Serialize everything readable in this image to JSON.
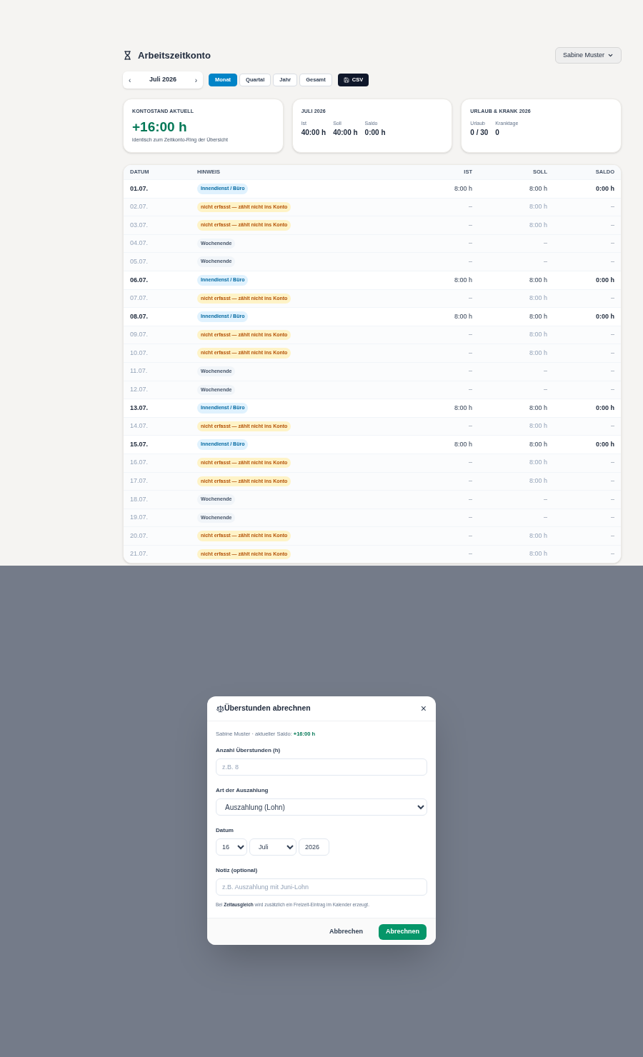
{
  "header": {
    "title": "Arbeitszeitkonto",
    "employee": "Sabine Muster"
  },
  "period_nav": {
    "prev": "‹",
    "label": "Juli 2026",
    "next": "›"
  },
  "ranges": [
    {
      "label": "Monat",
      "selected": true
    },
    {
      "label": "Quartal",
      "selected": false
    },
    {
      "label": "Jahr",
      "selected": false
    },
    {
      "label": "Gesamt",
      "selected": false
    }
  ],
  "export_button": "CSV",
  "cards": [
    {
      "kind": "balance",
      "title": "KONTOSTAND AKTUELL",
      "value": "+16:00 h",
      "caption": "identisch zum Zeitkonto-Ring der Übersicht"
    },
    {
      "kind": "stats",
      "title": "JULI 2026",
      "stats": [
        {
          "label": "Ist",
          "value": "40:00 h"
        },
        {
          "label": "Soll",
          "value": "40:00 h"
        },
        {
          "label": "Saldo",
          "value": "0:00 h"
        }
      ]
    },
    {
      "kind": "stats",
      "title": "URLAUB & KRANK 2026",
      "stats": [
        {
          "label": "Urlaub",
          "value": "0 / 30"
        },
        {
          "label": "Kranktage",
          "value": "0"
        }
      ]
    }
  ],
  "table": {
    "columns": [
      "DATUM",
      "HINWEIS",
      "IST",
      "SOLL",
      "SALDO"
    ],
    "rows": [
      {
        "kind": "office",
        "date": "01.07.",
        "note": "Innendienst / Büro",
        "ist": "8:00 h",
        "soll": "8:00 h",
        "saldo": "0:00 h"
      },
      {
        "kind": "missing",
        "date": "02.07.",
        "note": "nicht erfasst — zählt nicht ins Konto",
        "ist": "–",
        "soll": "8:00 h",
        "saldo": "–"
      },
      {
        "kind": "missing",
        "date": "03.07.",
        "note": "nicht erfasst — zählt nicht ins Konto",
        "ist": "–",
        "soll": "8:00 h",
        "saldo": "–"
      },
      {
        "kind": "weekend",
        "date": "04.07.",
        "note": "Wochenende",
        "ist": "–",
        "soll": "–",
        "saldo": "–"
      },
      {
        "kind": "weekend",
        "date": "05.07.",
        "note": "Wochenende",
        "ist": "–",
        "soll": "–",
        "saldo": "–"
      },
      {
        "kind": "office",
        "date": "06.07.",
        "note": "Innendienst / Büro",
        "ist": "8:00 h",
        "soll": "8:00 h",
        "saldo": "0:00 h"
      },
      {
        "kind": "missing",
        "date": "07.07.",
        "note": "nicht erfasst — zählt nicht ins Konto",
        "ist": "–",
        "soll": "8:00 h",
        "saldo": "–"
      },
      {
        "kind": "office",
        "date": "08.07.",
        "note": "Innendienst / Büro",
        "ist": "8:00 h",
        "soll": "8:00 h",
        "saldo": "0:00 h"
      },
      {
        "kind": "missing",
        "date": "09.07.",
        "note": "nicht erfasst — zählt nicht ins Konto",
        "ist": "–",
        "soll": "8:00 h",
        "saldo": "–"
      },
      {
        "kind": "missing",
        "date": "10.07.",
        "note": "nicht erfasst — zählt nicht ins Konto",
        "ist": "–",
        "soll": "8:00 h",
        "saldo": "–"
      },
      {
        "kind": "weekend",
        "date": "11.07.",
        "note": "Wochenende",
        "ist": "–",
        "soll": "–",
        "saldo": "–"
      },
      {
        "kind": "weekend",
        "date": "12.07.",
        "note": "Wochenende",
        "ist": "–",
        "soll": "–",
        "saldo": "–"
      },
      {
        "kind": "office",
        "date": "13.07.",
        "note": "Innendienst / Büro",
        "ist": "8:00 h",
        "soll": "8:00 h",
        "saldo": "0:00 h"
      },
      {
        "kind": "missing",
        "date": "14.07.",
        "note": "nicht erfasst — zählt nicht ins Konto",
        "ist": "–",
        "soll": "8:00 h",
        "saldo": "–"
      },
      {
        "kind": "office",
        "date": "15.07.",
        "note": "Innendienst / Büro",
        "ist": "8:00 h",
        "soll": "8:00 h",
        "saldo": "0:00 h"
      },
      {
        "kind": "missing",
        "date": "16.07.",
        "note": "nicht erfasst — zählt nicht ins Konto",
        "ist": "–",
        "soll": "8:00 h",
        "saldo": "–"
      },
      {
        "kind": "missing",
        "date": "17.07.",
        "note": "nicht erfasst — zählt nicht ins Konto",
        "ist": "–",
        "soll": "8:00 h",
        "saldo": "–"
      },
      {
        "kind": "weekend",
        "date": "18.07.",
        "note": "Wochenende",
        "ist": "–",
        "soll": "–",
        "saldo": "–"
      },
      {
        "kind": "weekend",
        "date": "19.07.",
        "note": "Wochenende",
        "ist": "–",
        "soll": "–",
        "saldo": "–"
      },
      {
        "kind": "missing",
        "date": "20.07.",
        "note": "nicht erfasst — zählt nicht ins Konto",
        "ist": "–",
        "soll": "8:00 h",
        "saldo": "–"
      },
      {
        "kind": "missing",
        "date": "21.07.",
        "note": "nicht erfasst — zählt nicht ins Konto",
        "ist": "–",
        "soll": "8:00 h",
        "saldo": "–"
      }
    ]
  },
  "dialog": {
    "title": "Überstunden abrechnen",
    "close": "×",
    "summary": "Sabine Muster · aktueller Saldo: **+16:00 h**",
    "hours": {
      "label": "Anzahl Überstunden (h)",
      "placeholder": "z.B. 8"
    },
    "payout_type": {
      "label": "Art der Auszahlung",
      "value": "Auszahlung (Lohn)"
    },
    "date": {
      "label": "Datum",
      "day": "16",
      "month": "Juli",
      "year": "2026"
    },
    "note": {
      "label": "Notiz (optional)",
      "placeholder": "z.B. Auszahlung mit Juni-Lohn"
    },
    "hint": "Bei **Zeitausgleich** wird zusätzlich ein Freizeit-Eintrag im Kalender erzeugt.",
    "buttons": [
      {
        "kind": "secondary",
        "label": "Abbrechen"
      },
      {
        "kind": "primary",
        "label": "Abrechnen"
      }
    ]
  }
}
